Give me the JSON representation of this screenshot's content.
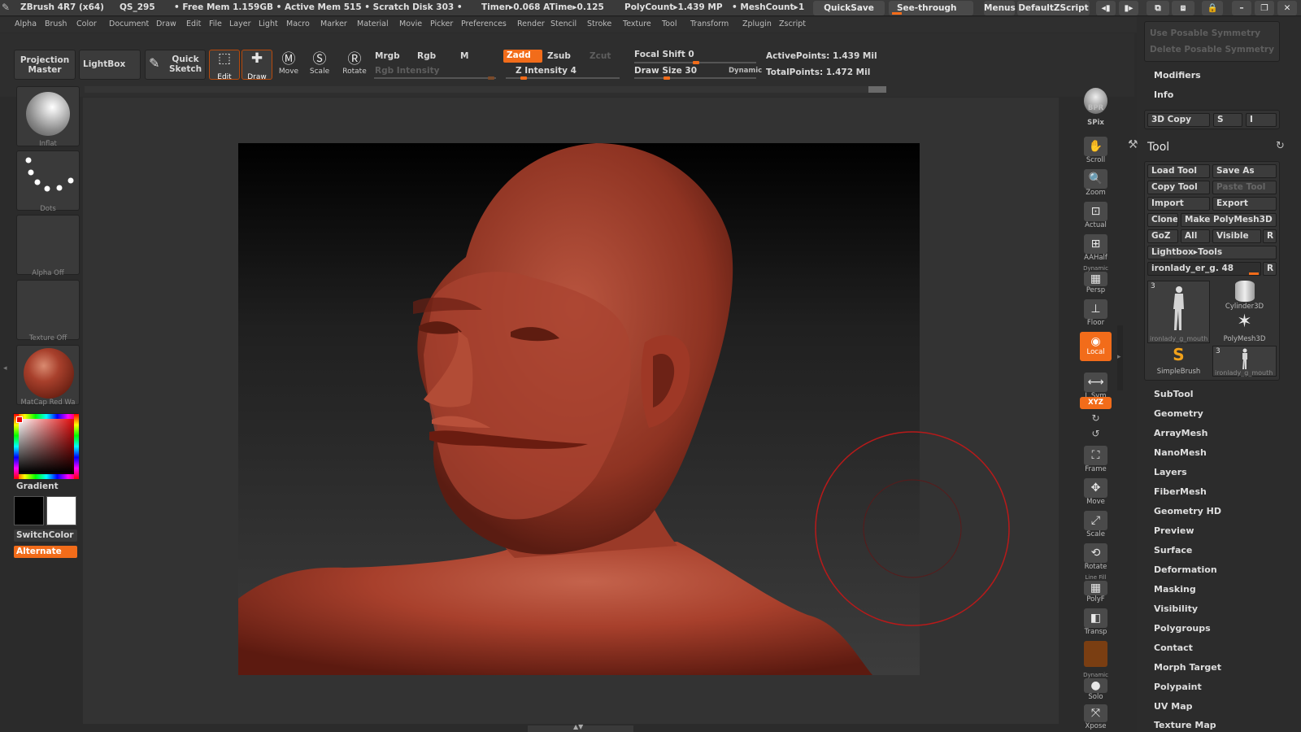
{
  "titlebar": {
    "app": "ZBrush 4R7 (x64)",
    "doc": "QS_295",
    "status": "• Free Mem 1.159GB • Active Mem 515 • Scratch Disk 303 •",
    "timer": "Timer▸0.068 ATime▸0.125",
    "polycount": "PolyCount▸1.439 MP",
    "meshcount": "• MeshCount▸1",
    "quicksave": "QuickSave",
    "seethrough": "See-through",
    "seethrough_value": "0",
    "menus": "Menus",
    "script": "DefaultZScript"
  },
  "menubar": [
    "Alpha",
    "Brush",
    "Color",
    "Document",
    "Draw",
    "Edit",
    "File",
    "Layer",
    "Light",
    "Macro",
    "Marker",
    "Material",
    "Movie",
    "Picker",
    "Preferences",
    "Render",
    "Stencil",
    "Stroke",
    "Texture",
    "Tool",
    "Transform",
    "Zplugin",
    "Zscript"
  ],
  "toolbar": {
    "projection_master": "Projection Master",
    "lightbox": "LightBox",
    "quick_sketch": "Quick Sketch",
    "edit": "Edit",
    "draw": "Draw",
    "move": "Move",
    "scale": "Scale",
    "rotate": "Rotate",
    "mrgb": "Mrgb",
    "rgb": "Rgb",
    "m": "M",
    "zadd": "Zadd",
    "zsub": "Zsub",
    "zcut": "Zcut",
    "rgb_intensity": "Rgb Intensity",
    "z_intensity": "Z Intensity 4",
    "focal_shift": "Focal Shift 0",
    "draw_size": "Draw Size 30",
    "dynamic": "Dynamic",
    "active_points": "ActivePoints: 1.439 Mil",
    "total_points": "TotalPoints: 1.472 Mil",
    "z_intensity_level": 0.04,
    "draw_size_level": 0.24
  },
  "shelf": {
    "brush": "Inflat",
    "stroke": "Dots",
    "alpha": "Alpha Off",
    "texture": "Texture Off",
    "material": "MatCap Red Wa",
    "gradient": "Gradient",
    "switchcolor": "SwitchColor",
    "alternate": "Alternate"
  },
  "right_icons": [
    "BPR",
    "SPix",
    "Scroll",
    "Zoom",
    "Actual",
    "AAHalf",
    "Persp",
    "Floor",
    "Local",
    "L.Sym",
    "XYZ",
    "Frame",
    "Move",
    "Scale",
    "Rotate",
    "PolyF",
    "Transp",
    "Ghost",
    "Solo",
    "Xpose"
  ],
  "right_icon_extra": {
    "dynamic": "Dynamic",
    "linefill": "Line Fill"
  },
  "panel": {
    "top_dim_1": "Use Posable Symmetry",
    "top_dim_2": "Delete Posable Symmetry",
    "modifiers": "Modifiers",
    "info": "Info",
    "copy3d": "3D Copy",
    "copy_s": "S",
    "copy_i": "I",
    "tool_title": "Tool",
    "load_tool": "Load Tool",
    "save_as": "Save As",
    "copy_tool": "Copy Tool",
    "paste_tool": "Paste Tool",
    "import": "Import",
    "export": "Export",
    "clone": "Clone",
    "make_polymesh": "Make PolyMesh3D",
    "goz": "GoZ",
    "all": "All",
    "visible": "Visible",
    "r": "R",
    "lightbox_tools": "Lightbox▸Tools",
    "current_tool": "ironlady_er_g. 48",
    "thumbs": [
      {
        "label": "ironlady_g_mouth",
        "badge": "3"
      },
      {
        "label": "Cylinder3D",
        "badge": ""
      },
      {
        "label": "PolyMesh3D",
        "badge": ""
      },
      {
        "label": "SimpleBrush",
        "badge": ""
      },
      {
        "label": "ironlady_g_mouth",
        "badge": "3"
      }
    ],
    "sections": [
      "SubTool",
      "Geometry",
      "ArrayMesh",
      "NanoMesh",
      "Layers",
      "FiberMesh",
      "Geometry HD",
      "Preview",
      "Surface",
      "Deformation",
      "Masking",
      "Visibility",
      "Polygroups",
      "Contact",
      "Morph Target",
      "Polypaint",
      "UV Map",
      "Texture Map"
    ]
  },
  "colors": {
    "accent": "#f26c1a",
    "model": "#a8402c",
    "brush_ring": "#b81a1a"
  }
}
